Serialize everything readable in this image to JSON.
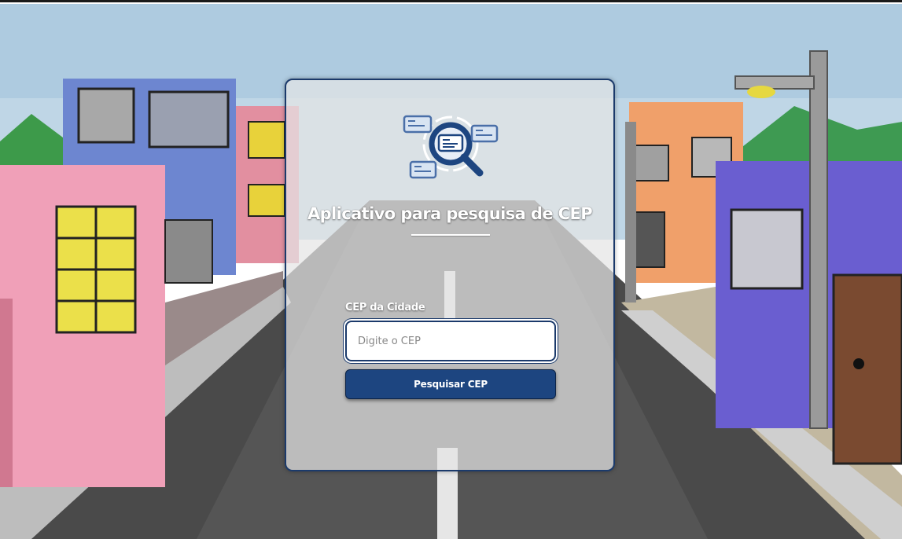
{
  "app": {
    "title": "Aplicativo para pesquisa de CEP"
  },
  "form": {
    "label": "CEP da Cidade",
    "input_placeholder": "Digite o CEP",
    "input_value": "",
    "button_label": "Pesquisar CEP"
  },
  "icons": {
    "logo": "search-address-cards-icon"
  },
  "colors": {
    "accent": "#1d4580",
    "border": "#1b3a6b",
    "card_background": "#e4e4e4"
  }
}
